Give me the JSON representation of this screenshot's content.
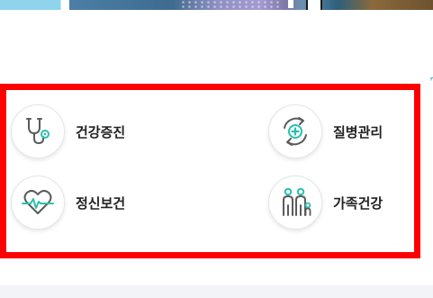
{
  "services": [
    {
      "label": "건강증진",
      "icon": "stethoscope-icon"
    },
    {
      "label": "질병관리",
      "icon": "disease-care-icon"
    },
    {
      "label": "정신보건",
      "icon": "heart-pulse-icon"
    },
    {
      "label": "가족건강",
      "icon": "family-icon"
    }
  ],
  "colors": {
    "accent": "#2bbfb0",
    "icon_stroke": "#5b5b5b",
    "highlight_frame": "#ff0000",
    "label_text": "#222222"
  }
}
